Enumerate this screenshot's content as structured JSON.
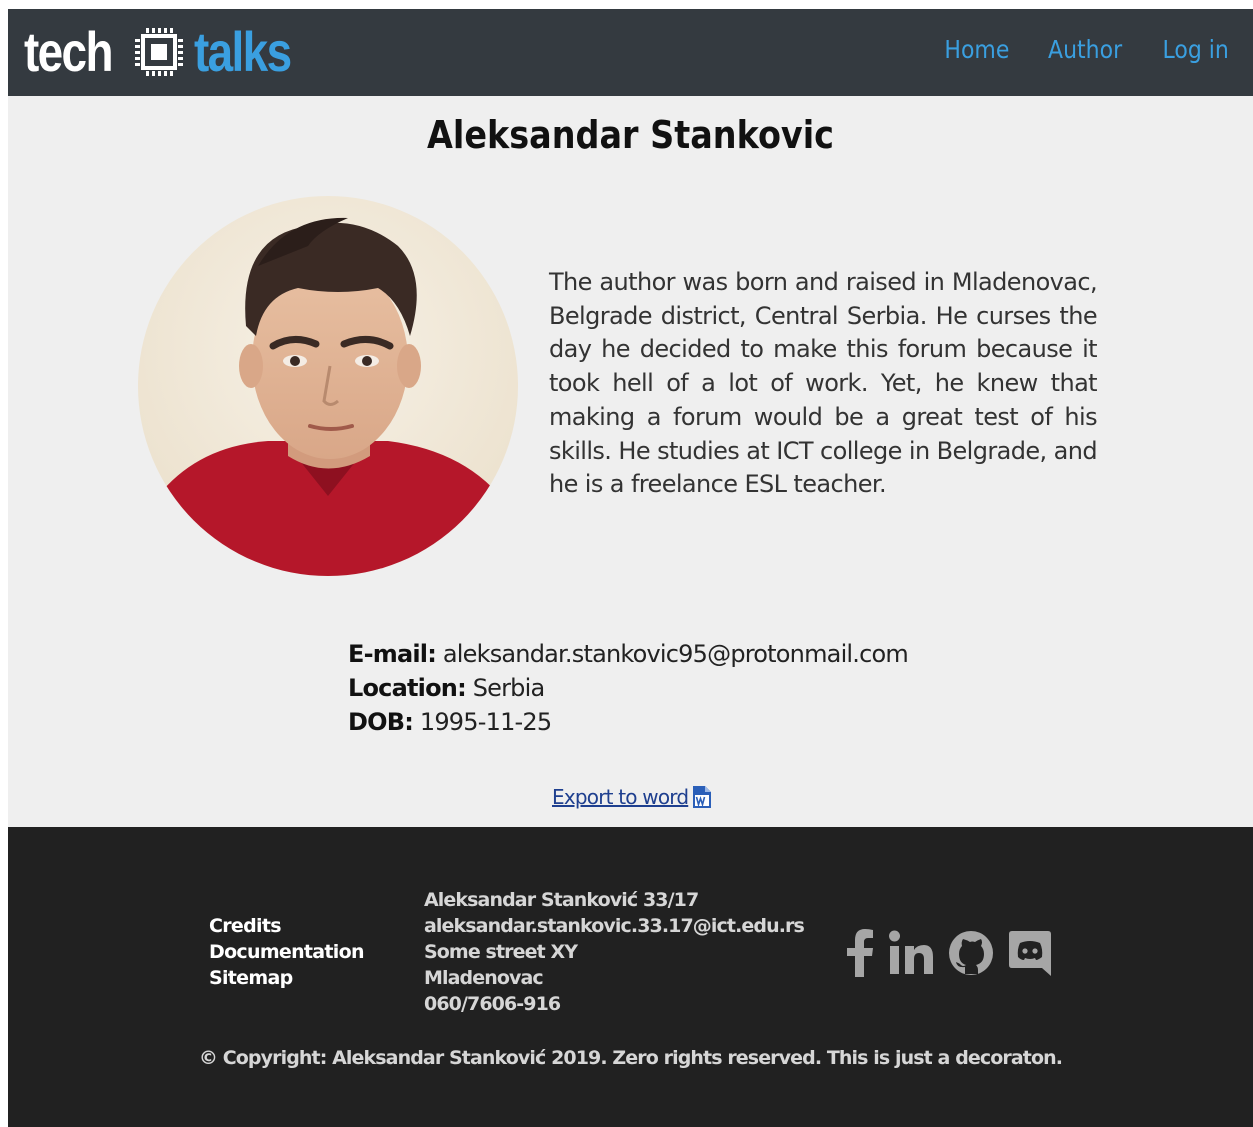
{
  "header": {
    "logo_left": "tech",
    "logo_right": "talks",
    "nav": [
      {
        "label": "Home"
      },
      {
        "label": "Author"
      },
      {
        "label": "Log in"
      }
    ]
  },
  "author": {
    "name": "Aleksandar Stankovic",
    "bio": "The author was born and raised in Mladenovac, Belgrade district, Central Serbia. He curses the day he decided to make this forum because it took hell of a lot of work. Yet, he knew that making a forum would be a great test of his skills. He studies at ICT college in Belgrade, and he is a freelance ESL teacher.",
    "email_label": "E-mail:",
    "email": "aleksandar.stankovic95@protonmail.com",
    "location_label": "Location:",
    "location": "Serbia",
    "dob_label": "DOB:",
    "dob": "1995-11-25",
    "export_label": "Export to word"
  },
  "footer": {
    "links": [
      {
        "label": "Credits"
      },
      {
        "label": "Documentation"
      },
      {
        "label": "Sitemap"
      }
    ],
    "contact": [
      "Aleksandar Stanković 33/17",
      "aleksandar.stankovic.33.17@ict.edu.rs",
      "Some street XY",
      "Mladenovac",
      "060/7606-916"
    ],
    "social_icons": [
      "facebook-icon",
      "linkedin-icon",
      "github-icon",
      "discord-icon"
    ],
    "copyright": "© Copyright: Aleksandar Stanković 2019. Zero rights reserved. This is just a decoraton."
  },
  "colors": {
    "nav_bg": "#343a40",
    "accent": "#3a9fe0",
    "footer_bg": "#212121",
    "page_bg": "#efefef"
  }
}
